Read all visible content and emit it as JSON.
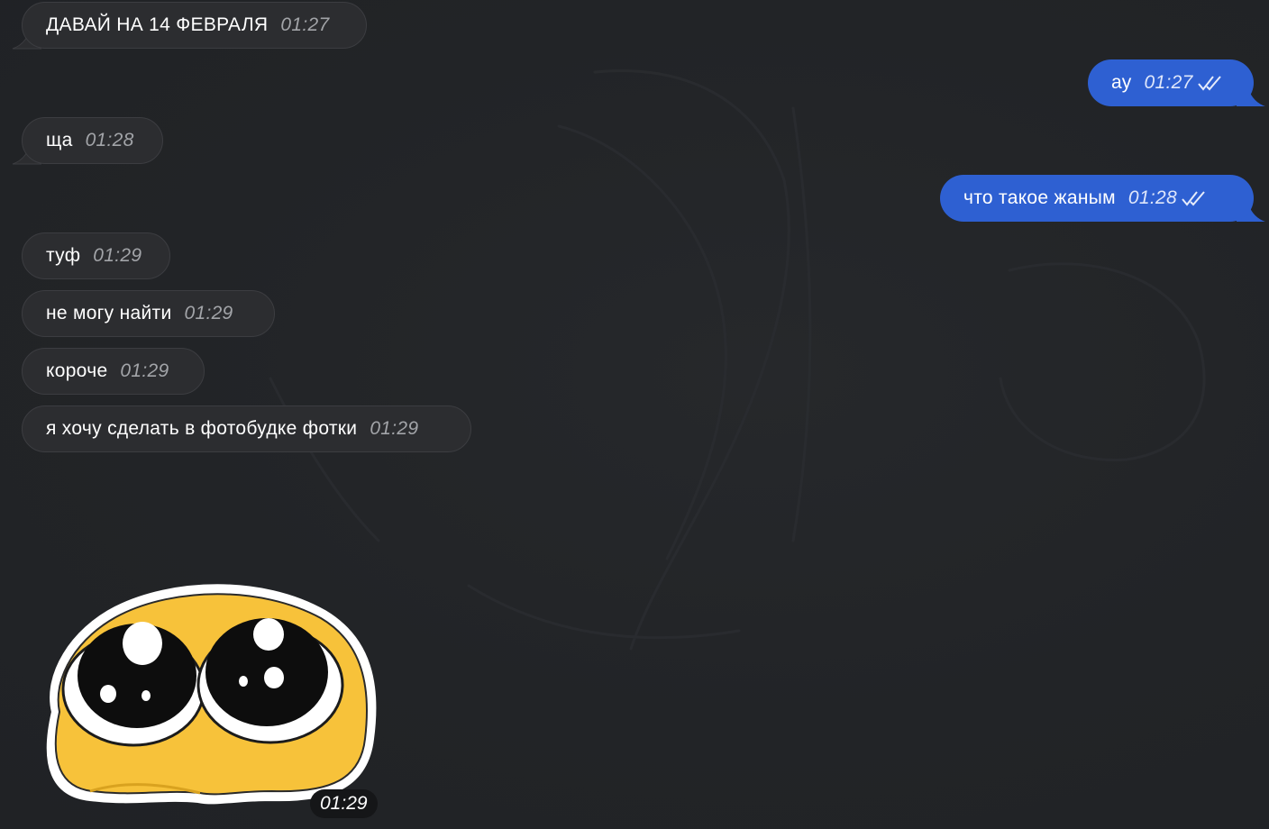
{
  "messages": [
    {
      "text": "ДАВАЙ НА 14 ФЕВРАЛЯ",
      "time": "01:27",
      "direction": "incoming"
    },
    {
      "text": "ау",
      "time": "01:27",
      "direction": "outgoing",
      "status_icon": "double-check-icon"
    },
    {
      "text": "ща",
      "time": "01:28",
      "direction": "incoming"
    },
    {
      "text": "что такое жаным",
      "time": "01:28",
      "direction": "outgoing",
      "status_icon": "double-check-icon"
    },
    {
      "text": "туф",
      "time": "01:29",
      "direction": "incoming"
    },
    {
      "text": "не могу найти",
      "time": "01:29",
      "direction": "incoming"
    },
    {
      "text": "короче",
      "time": "01:29",
      "direction": "incoming"
    },
    {
      "text": "я хочу сделать в фотобудке фотки",
      "time": "01:29",
      "direction": "incoming"
    }
  ],
  "sticker": {
    "icon": "pleading-face-sticker",
    "time": "01:29"
  },
  "colors": {
    "background": "#232528",
    "incoming_bubble": "#2c2d30",
    "outgoing_bubble": "#2e60d2",
    "sticker_face": "#f7c23a"
  }
}
